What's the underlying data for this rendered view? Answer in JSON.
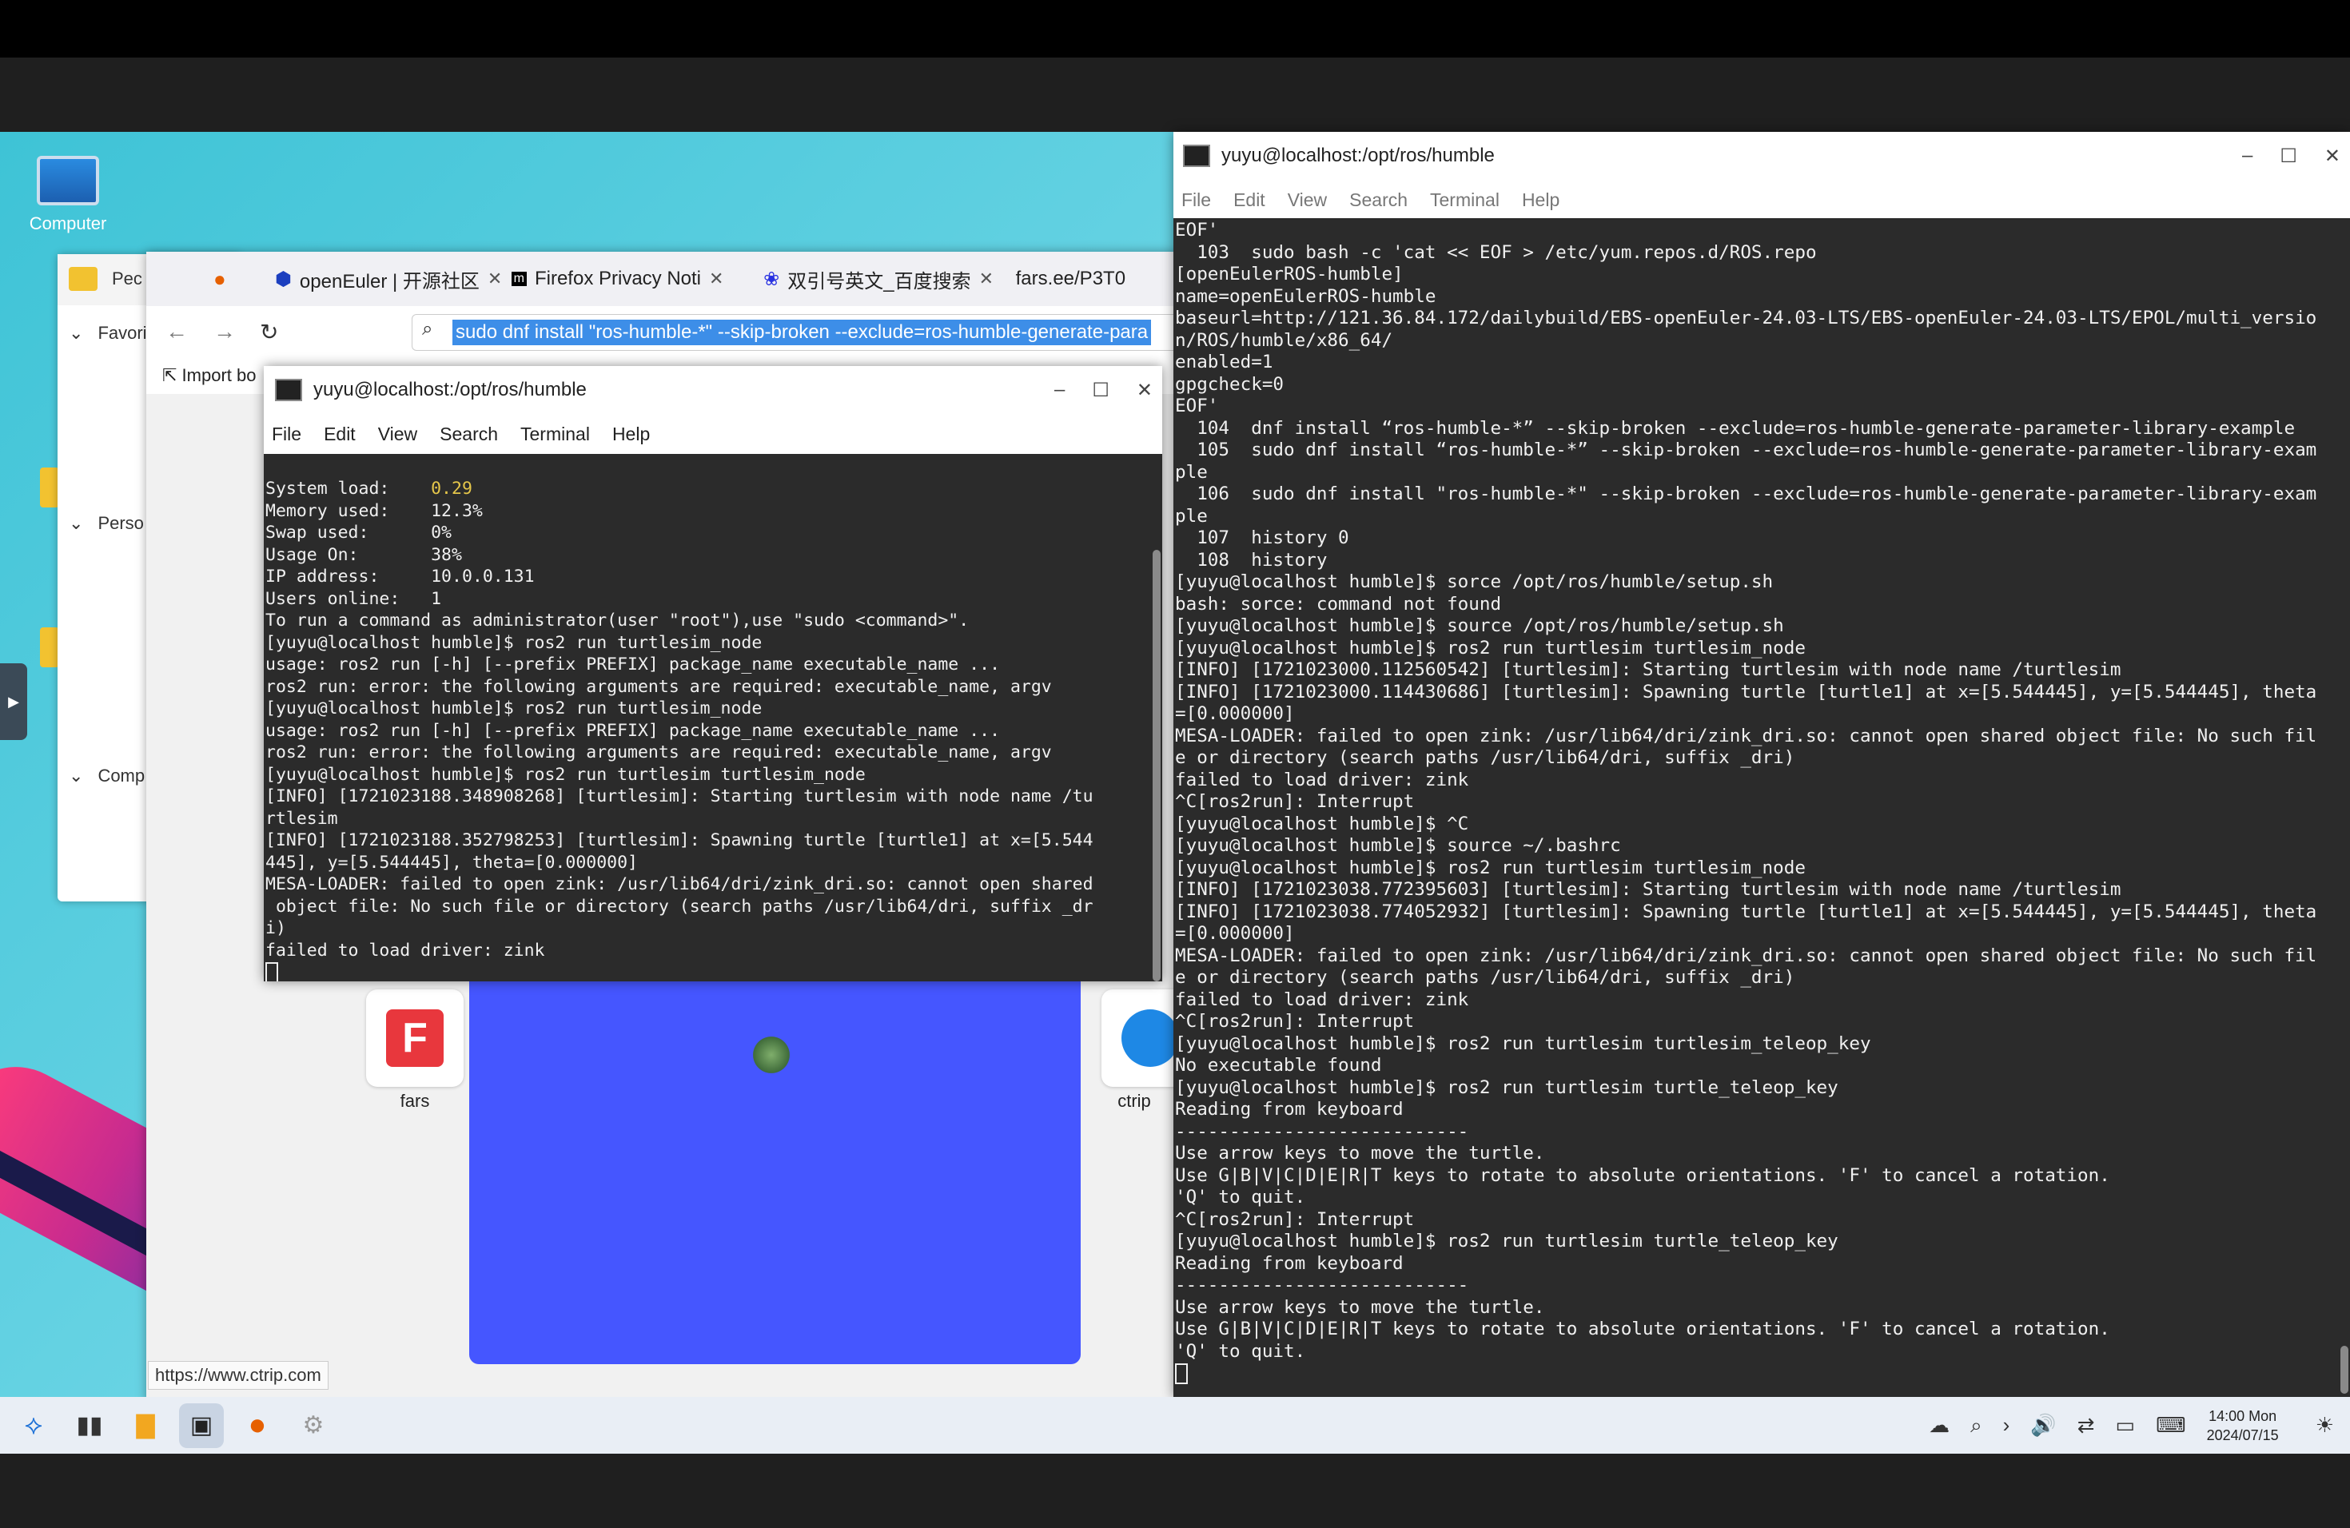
{
  "desktop": {
    "computer_label": "Computer"
  },
  "file_manager": {
    "sidebar": [
      "Pec",
      "Favori",
      "Perso",
      "Comp"
    ]
  },
  "browser": {
    "tabs": [
      {
        "label": "openEuler | 开源社区"
      },
      {
        "label": "Firefox Privacy Noti"
      },
      {
        "label": "双引号英文_百度搜索"
      },
      {
        "label": "fars.ee/P3T0"
      }
    ],
    "url": "sudo dnf install \"ros-humble-*\" --skip-broken --exclude=ros-humble-generate-para",
    "bookmarks_label": "Import bo",
    "tiles": [
      {
        "label": "fars"
      },
      {
        "label": "ctrip"
      }
    ],
    "status_url": "https://www.ctrip.com"
  },
  "terminal_front": {
    "title": "yuyu@localhost:/opt/ros/humble",
    "menu": [
      "File",
      "Edit",
      "View",
      "Search",
      "Terminal",
      "Help"
    ],
    "load_value": "0.29",
    "lines": [
      "System load:    ",
      "Memory used:    12.3%",
      "Swap used:      0%",
      "Usage On:       38%",
      "IP address:     10.0.0.131",
      "Users online:   1",
      "To run a command as administrator(user \"root\"),use \"sudo <command>\".",
      "[yuyu@localhost humble]$ ros2 run turtlesim_node",
      "usage: ros2 run [-h] [--prefix PREFIX] package_name executable_name ...",
      "ros2 run: error: the following arguments are required: executable_name, argv",
      "[yuyu@localhost humble]$ ros2 run turtlesim_node",
      "usage: ros2 run [-h] [--prefix PREFIX] package_name executable_name ...",
      "ros2 run: error: the following arguments are required: executable_name, argv",
      "[yuyu@localhost humble]$ ros2 run turtlesim turtlesim_node",
      "[INFO] [1721023188.348908268] [turtlesim]: Starting turtlesim with node name /tu",
      "rtlesim",
      "[INFO] [1721023188.352798253] [turtlesim]: Spawning turtle [turtle1] at x=[5.544",
      "445], y=[5.544445], theta=[0.000000]",
      "MESA-LOADER: failed to open zink: /usr/lib64/dri/zink_dri.so: cannot open shared",
      " object file: No such file or directory (search paths /usr/lib64/dri, suffix _dr",
      "i)",
      "failed to load driver: zink"
    ]
  },
  "terminal_right": {
    "title": "yuyu@localhost:/opt/ros/humble",
    "menu": [
      "File",
      "Edit",
      "View",
      "Search",
      "Terminal",
      "Help"
    ],
    "lines": [
      "EOF'",
      "  103  sudo bash -c 'cat << EOF > /etc/yum.repos.d/ROS.repo",
      "[openEulerROS-humble]",
      "name=openEulerROS-humble",
      "baseurl=http://121.36.84.172/dailybuild/EBS-openEuler-24.03-LTS/EBS-openEuler-24.03-LTS/EPOL/multi_versio",
      "n/ROS/humble/x86_64/",
      "enabled=1",
      "gpgcheck=0",
      "EOF'",
      "  104  dnf install “ros-humble-*” --skip-broken --exclude=ros-humble-generate-parameter-library-example",
      "  105  sudo dnf install “ros-humble-*” --skip-broken --exclude=ros-humble-generate-parameter-library-exam",
      "ple",
      "  106  sudo dnf install \"ros-humble-*\" --skip-broken --exclude=ros-humble-generate-parameter-library-exam",
      "ple",
      "  107  history 0",
      "  108  history",
      "[yuyu@localhost humble]$ sorce /opt/ros/humble/setup.sh",
      "bash: sorce: command not found",
      "[yuyu@localhost humble]$ source /opt/ros/humble/setup.sh",
      "[yuyu@localhost humble]$ ros2 run turtlesim turtlesim_node",
      "[INFO] [1721023000.112560542] [turtlesim]: Starting turtlesim with node name /turtlesim",
      "[INFO] [1721023000.114430686] [turtlesim]: Spawning turtle [turtle1] at x=[5.544445], y=[5.544445], theta",
      "=[0.000000]",
      "MESA-LOADER: failed to open zink: /usr/lib64/dri/zink_dri.so: cannot open shared object file: No such fil",
      "e or directory (search paths /usr/lib64/dri, suffix _dri)",
      "failed to load driver: zink",
      "^C[ros2run]: Interrupt",
      "[yuyu@localhost humble]$ ^C",
      "[yuyu@localhost humble]$ source ~/.bashrc",
      "[yuyu@localhost humble]$ ros2 run turtlesim turtlesim_node",
      "[INFO] [1721023038.772395603] [turtlesim]: Starting turtlesim with node name /turtlesim",
      "[INFO] [1721023038.774052932] [turtlesim]: Spawning turtle [turtle1] at x=[5.544445], y=[5.544445], theta",
      "=[0.000000]",
      "MESA-LOADER: failed to open zink: /usr/lib64/dri/zink_dri.so: cannot open shared object file: No such fil",
      "e or directory (search paths /usr/lib64/dri, suffix _dri)",
      "failed to load driver: zink",
      "^C[ros2run]: Interrupt",
      "[yuyu@localhost humble]$ ros2 run turtlesim turtlesim_teleop_key",
      "No executable found",
      "[yuyu@localhost humble]$ ros2 run turtlesim turtle_teleop_key",
      "Reading from keyboard",
      "---------------------------",
      "Use arrow keys to move the turtle.",
      "Use G|B|V|C|D|E|R|T keys to rotate to absolute orientations. 'F' to cancel a rotation.",
      "'Q' to quit.",
      "^C[ros2run]: Interrupt",
      "[yuyu@localhost humble]$ ros2 run turtlesim turtle_teleop_key",
      "Reading from keyboard",
      "---------------------------",
      "Use arrow keys to move the turtle.",
      "Use G|B|V|C|D|E|R|T keys to rotate to absolute orientations. 'F' to cancel a rotation.",
      "'Q' to quit."
    ]
  },
  "taskbar": {
    "time": "14:00 Mon",
    "date": "2024/07/15"
  }
}
